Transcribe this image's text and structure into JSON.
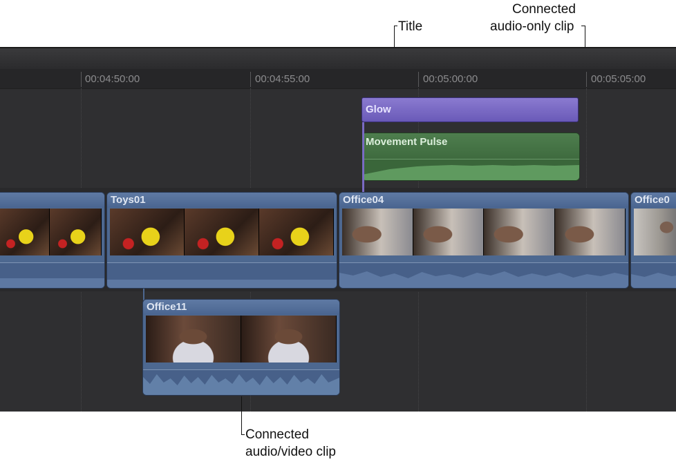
{
  "callouts": {
    "title": "Title",
    "connected_audio_only_line1": "Connected",
    "connected_audio_only_line2": "audio-only clip",
    "connected_av_line1": "Connected",
    "connected_av_line2": "audio/video clip"
  },
  "ruler": {
    "ticks": [
      "00:04:50:00",
      "00:04:55:00",
      "00:05:00:00",
      "00:05:05:00"
    ]
  },
  "clips": {
    "title_clip": "Glow",
    "music_clip": "Movement Pulse",
    "primary_2": "Toys01",
    "primary_3": "Office04",
    "primary_4": "Office0",
    "connected_av": "Office11"
  },
  "colors": {
    "timeline_bg": "#2f2f31",
    "av_clip": "#4d6890",
    "title_clip": "#7a6ac4",
    "audio_clip": "#3f6b3f"
  }
}
